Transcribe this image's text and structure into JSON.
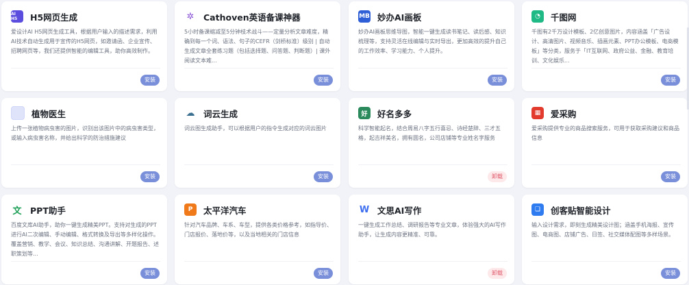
{
  "cards": [
    {
      "name": "h5",
      "title": "H5网页生成",
      "icon": "h5-ai-icon",
      "icon_bg": "#5b4dde",
      "icon_text": "AI H5",
      "desc": "爱设计AI H5网页生成工具，根据用户输入的描述需求，利用AI技术自动生成用于宣传的H5网页，如邀请函、企业宣传、招聘网页等，我们还提供智能的编辑工具，助你高效制作。",
      "button": "安装",
      "installed": false
    },
    {
      "name": "cathoven",
      "title": "Cathoven英语备课神器",
      "icon": "cathoven-icon",
      "icon_bg": "#ffffff",
      "icon_text": "✲",
      "desc": "5小时备课缩减至5分钟枝术战斗——定量分析文章难度，精确到每一个词、语法、句子的CEFR（剑桥标准）级别 | 自动生成文章全套练习题（包括选择题、问答题、判断题）| 课外阅读文本难...",
      "button": "安装",
      "installed": false
    },
    {
      "name": "miaoban",
      "title": "妙办AI画板",
      "icon": "miaoban-icon",
      "icon_bg": "#2f5fd6",
      "icon_text": "MB",
      "desc": "妙办AI画板思维导图，智能一键生成读书笔记、读后感、知识梳理等，支持灵活在线编辑与实时导出，更加高效的提升自己的工作效率、学习能力、个人提升。",
      "button": "安装",
      "installed": false
    },
    {
      "name": "qiantu",
      "title": "千图网",
      "icon": "qiantu-icon",
      "icon_bg": "#1fb985",
      "icon_text": "◔",
      "desc": "千图有2千万设计模板、2亿创意图片，内容涵盖「广告设计、高清图片、视频音乐、插画元素、PPT办公模板、电商模板」等分类，服务于「IT互联网、政府公益、金融、教育培训、文化娱乐...",
      "button": "安装",
      "installed": false
    },
    {
      "name": "plant-doctor",
      "title": "植物医生",
      "icon": "plant-doctor-icon",
      "icon_bg": "#dfe4fb",
      "icon_text": "",
      "desc": "上传一张植物病虫害的图片，识别出该图片中的病虫害类型，或输入病虫害名称，并给出科学的防治措施建议",
      "button": "安装",
      "installed": false
    },
    {
      "name": "wordcloud",
      "title": "词云生成",
      "icon": "wordcloud-icon",
      "icon_bg": "#ffffff",
      "icon_text": "☁",
      "desc": "词云图生成助手，可以根据用户的指令生成对应的词云图片",
      "button": "安装",
      "installed": false
    },
    {
      "name": "haoming",
      "title": "好名多多",
      "icon": "haoming-icon",
      "icon_bg": "#2a8a5c",
      "icon_text": "好",
      "desc": "科学智能起名，结合周易八字五行喜忌、诗经楚辞、三才五格，起吉祥美名，拥有圆名，公司店铺等专业姓名字服务",
      "button": "卸载",
      "installed": true
    },
    {
      "name": "aicaigou",
      "title": "爱采购",
      "icon": "aicaigou-icon",
      "icon_bg": "#e23b2e",
      "icon_text": "▦",
      "desc": "爱采购提供专业的商品搜索服务，可用于获取采购建议和商品信息",
      "button": "安装",
      "installed": false
    },
    {
      "name": "ppt",
      "title": "PPT助手",
      "icon": "ppt-icon",
      "icon_bg": "#ffffff",
      "icon_text": "文",
      "desc": "百度文库AI助手，助你一键生成精美PPT。支持对生成的PPT进行AI二次编辑、手动编辑、格式转换及导出等多样化操作。覆盖营销、教学、会议、知识总结、沟通讲解、开题报告、述职策划等...",
      "button": "安装",
      "installed": false
    },
    {
      "name": "pacific-auto",
      "title": "太平洋汽车",
      "icon": "pacific-auto-icon",
      "icon_bg": "#f07a1a",
      "icon_text": "P",
      "desc": "针对汽车品牌、车系、车型，提供各类价格参考，如指导价、门店报价、落地价等，以及当地相关的门店信息",
      "button": "安装",
      "installed": false
    },
    {
      "name": "wensi",
      "title": "文思AI写作",
      "icon": "wensi-icon",
      "icon_bg": "#ffffff",
      "icon_text": "W",
      "desc": "一键生成工作总结、调研报告等专业文章，体验强大的AI写作助手，让生成内容更精准、可靠。",
      "button": "卸载",
      "installed": true
    },
    {
      "name": "chuangketie",
      "title": "创客贴智能设计",
      "icon": "chuangketie-icon",
      "icon_bg": "#2f7bf0",
      "icon_text": "❏",
      "desc": "输入设计需求，即刻生成精美设计图；涵盖手机海报、宣传图、电商图、店铺广告、日签、社交媒体配图等多样场景。",
      "button": "安装",
      "installed": false
    }
  ]
}
